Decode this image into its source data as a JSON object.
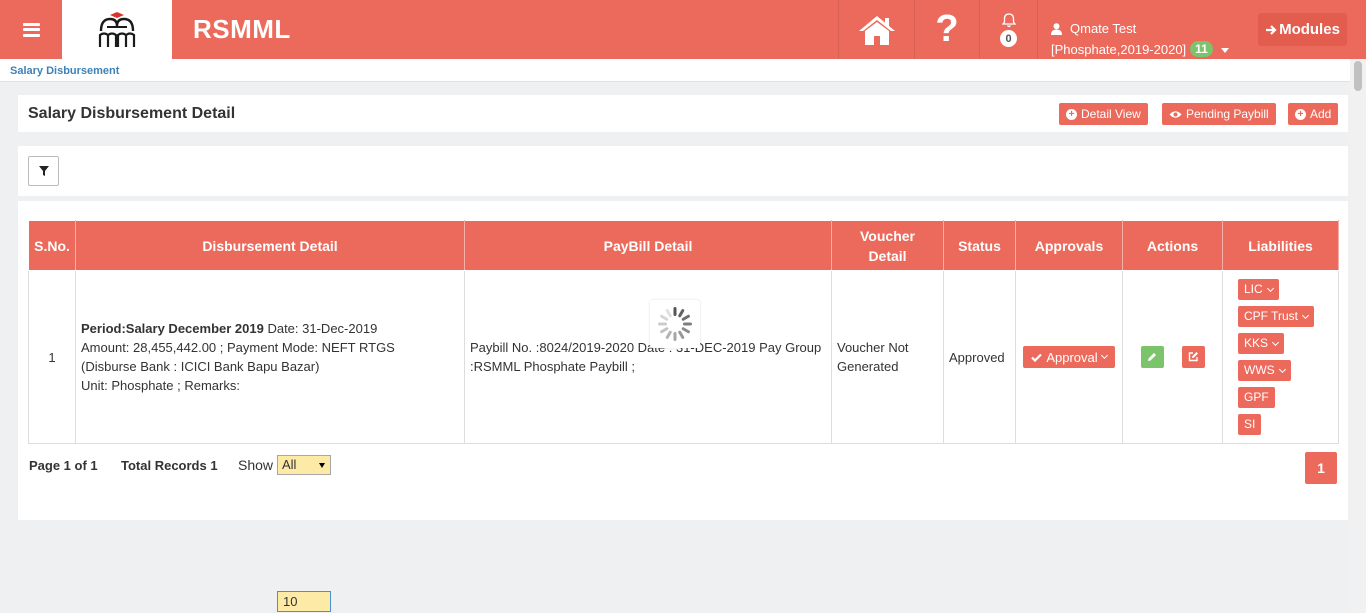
{
  "header": {
    "brand": "RSMML",
    "notifications_count": "0",
    "user_name": "Qmate Test",
    "user_context": "[Phosphate,2019-2020]",
    "user_badge": "11",
    "modules_label": "Modules",
    "help_glyph": "?"
  },
  "breadcrumb": {
    "current": "Salary Disbursement"
  },
  "page": {
    "title": "Salary Disbursement Detail",
    "buttons": {
      "detail_view": "Detail View",
      "pending_paybill": "Pending Paybill",
      "add": "Add"
    }
  },
  "table": {
    "columns": [
      "S.No.",
      "Disbursement Detail",
      "PayBill Detail",
      "Voucher Detail",
      "Status",
      "Approvals",
      "Actions",
      "Liabilities"
    ],
    "rows": [
      {
        "sno": "1",
        "period_label": "Period:Salary December 2019",
        "date": "Date: 31-Dec-2019",
        "amount_line": "Amount: 28,455,442.00 ; Payment Mode: NEFT RTGS",
        "bank_line": "(Disburse Bank : ICICI Bank Bapu Bazar)",
        "unit_line": "Unit: Phosphate ; Remarks:",
        "paybill": "Paybill No. :8024/2019-2020 Date : 31-DEC-2019 Pay Group :RSMML Phosphate Paybill ;",
        "voucher": "Voucher Not Generated",
        "status": "Approved",
        "approval_label": "Approval",
        "liabilities": [
          "LIC",
          "CPF Trust",
          "KKS",
          "WWS",
          "GPF",
          "SI"
        ]
      }
    ]
  },
  "pagination": {
    "page_info": "Page 1 of 1",
    "total_records": "Total Records 1",
    "show_label": "Show",
    "show_value": "All",
    "current_page": "1",
    "floating_value": "10"
  },
  "colors": {
    "accent": "#ec6a5b",
    "link": "#3c81b8",
    "success": "#7cc46b"
  }
}
